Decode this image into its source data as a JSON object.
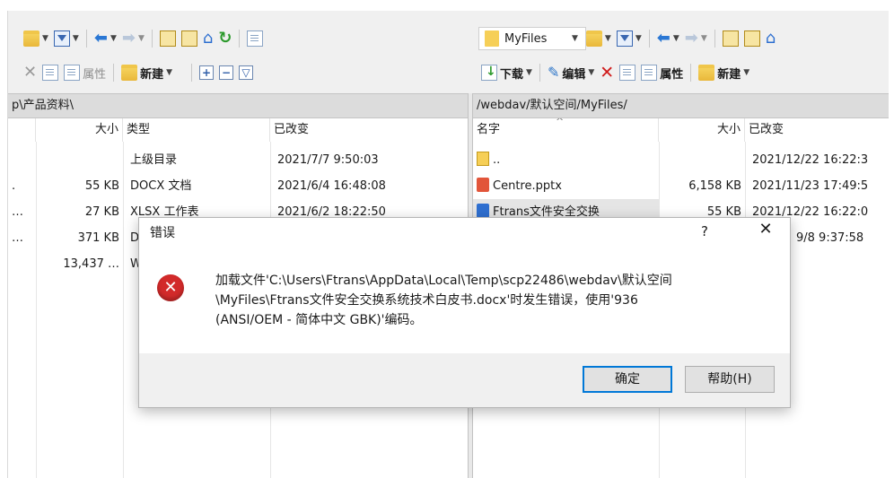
{
  "left_toolbar": {
    "properties_label": "属性",
    "new_label": "新建"
  },
  "right_toolbar": {
    "location_name": "MyFiles",
    "download_label": "下载",
    "edit_label": "编辑",
    "properties_label": "属性",
    "new_label": "新建"
  },
  "left_panel": {
    "path": "p\\产品资料\\",
    "columns": {
      "size": "大小",
      "type": "类型",
      "modified": "已改变"
    },
    "rows": [
      {
        "marker": "",
        "size": "",
        "type": "上级目录",
        "modified": "2021/7/7  9:50:03"
      },
      {
        "marker": ".",
        "size": "55 KB",
        "type": "DOCX 文档",
        "modified": "2021/6/4  16:48:08"
      },
      {
        "marker": "…",
        "size": "27 KB",
        "type": "XLSX 工作表",
        "modified": "2021/6/2  18:22:50"
      },
      {
        "marker": "…",
        "size": "371 KB",
        "type": "D",
        "modified": ""
      },
      {
        "marker": "",
        "size": "13,437 …",
        "type": "W",
        "modified": ""
      }
    ]
  },
  "right_panel": {
    "path": "/webdav/默认空间/MyFiles/",
    "columns": {
      "name": "名字",
      "size": "大小",
      "modified": "已改变"
    },
    "rows": [
      {
        "name": "..",
        "size": "",
        "modified": "2021/12/22 16:22:3"
      },
      {
        "name": "Centre.pptx",
        "size": "6,158 KB",
        "modified": "2021/11/23 17:49:5"
      },
      {
        "name": "Ftrans文件安全交换",
        "size": "55 KB",
        "modified": "2021/12/22 16:22:0"
      },
      {
        "name": "",
        "size": "",
        "modified": "9/8 9:37:58"
      }
    ]
  },
  "dialog": {
    "title": "错误",
    "help_glyph": "?",
    "close_glyph": "✕",
    "message": "加载文件'C:\\Users\\Ftrans\\AppData\\Local\\Temp\\scp22486\\webdav\\默认空间\n\\MyFiles\\Ftrans文件安全交换系统技术白皮书.docx'时发生错误，使用'936\n(ANSI/OEM - 简体中文 GBK)'编码。",
    "ok_label": "确定",
    "help_label": "帮助(H)"
  }
}
